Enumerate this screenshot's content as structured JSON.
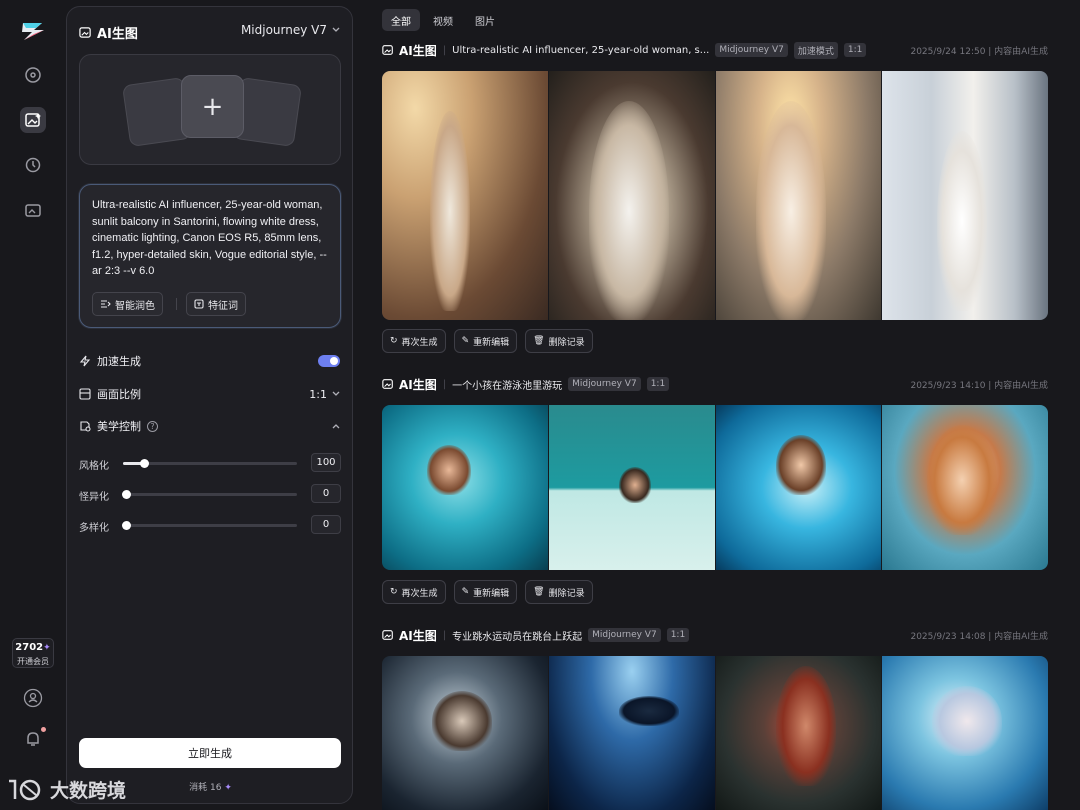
{
  "panel": {
    "title": "AI生图",
    "model": "Midjourney V7",
    "prompt": "Ultra-realistic AI influencer, 25-year-old woman, sunlit balcony in Santorini, flowing white dress, cinematic lighting, Canon EOS R5, 85mm lens, f1.2, hyper-detailed skin, Vogue editorial style, --ar 2:3 --v 6.0",
    "smart_polish": "智能润色",
    "feature_words": "特征词",
    "speed_label": "加速生成",
    "speed_on": true,
    "ratio_label": "画面比例",
    "ratio_value": "1:1",
    "aesthetic_label": "美学控制",
    "sliders": [
      {
        "label": "风格化",
        "value": "100",
        "fraction": 0.12
      },
      {
        "label": "怪异化",
        "value": "0",
        "fraction": 0.02
      },
      {
        "label": "多样化",
        "value": "0",
        "fraction": 0.02
      }
    ],
    "generate": "立即生成",
    "cost": "消耗 16"
  },
  "rail": {
    "credits": "2702",
    "vip": "开通会员"
  },
  "tabs": [
    "全部",
    "视频",
    "图片"
  ],
  "feed": [
    {
      "title": "AI生图",
      "prompt": "Ultra-realistic AI influencer, 25-year-old woman, s...",
      "tags": [
        "Midjourney V7",
        "加速模式",
        "1:1"
      ],
      "meta": "2025/9/24 12:50 | 内容由AI生成"
    },
    {
      "title": "AI生图",
      "prompt": "一个小孩在游泳池里游玩",
      "tags": [
        "Midjourney V7",
        "1:1"
      ],
      "meta": "2025/9/23 14:10 | 内容由AI生成"
    },
    {
      "title": "AI生图",
      "prompt": "专业跳水运动员在跳台上跃起",
      "tags": [
        "Midjourney V7",
        "1:1"
      ],
      "meta": "2025/9/23 14:08 | 内容由AI生成"
    }
  ],
  "actions": {
    "regenerate": "再次生成",
    "reedit": "重新编辑",
    "delete": "删除记录"
  },
  "watermark": "大数跨境",
  "icons": [
    "logo-icon",
    "explore-icon",
    "image-gen-icon",
    "history-icon",
    "assets-icon",
    "user-icon",
    "bell-icon",
    "menu-icon"
  ]
}
